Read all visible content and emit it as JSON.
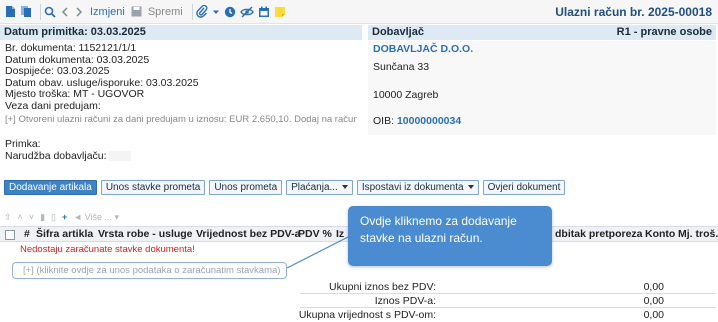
{
  "toolbar": {
    "izmjeni": "Izmjeni",
    "spremi": "Spremi"
  },
  "doc_title": "Ulazni račun br. 2025-00018",
  "left": {
    "header": "Datum primitka: 03.03.2025",
    "br_dokumenta": "Br. dokumenta: 1152121/1/1",
    "datum_dokumenta": "Datum dokumenta: 03.03.2025",
    "dospijece": "Dospijeće: 03.03.2025",
    "datum_obav": "Datum obav. usluge/isporuke: 03.03.2025",
    "mjesto_troska": "Mjesto troška: MT - UGOVOR",
    "veza": "Veza dani predujam:",
    "advance": "[+] Otvoreni ulazni računi za dani predujam u iznosu: EUR 2.650,10. Dodaj na račun...",
    "primka": "Primka:",
    "narudzba": "Narudžba dobavljaču:"
  },
  "right": {
    "header_left": "Dobavljač",
    "header_right": "R1 - pravne osobe",
    "name": "DOBAVLJAČ D.O.O.",
    "street": "Sunčana 33",
    "city": "10000   Zagreb",
    "oib_label": "OIB:",
    "oib_value": "10000000034"
  },
  "actions": {
    "dodavanje": "Dodavanje artikala",
    "unos_stavke": "Unos stavke prometa",
    "unos_prometa": "Unos prometa",
    "placanja": "Plaćanja...",
    "ispostavi": "Ispostavi iz dokumenta",
    "ovjeri": "Ovjeri dokument"
  },
  "gridbar": {
    "vise": "Više ..."
  },
  "table": {
    "col_num": "#",
    "col_sifra": "Šifra artikla",
    "col_vrsta": "Vrsta robe - usluge",
    "col_vrijednost": "Vrijednost bez PDV-a",
    "col_pdv": "PDV %",
    "col_iz": "Iz",
    "col_odbitak": "dbitak pretporeza",
    "col_konto": "Konto",
    "col_mj": "Mj. troš.",
    "missing": "Nedostaju zaračunate stavke dokumenta!",
    "add_row": "[+] (kliknite ovdje za unos podataka o zaračunatim stavkama)"
  },
  "totals": {
    "bez_pdv_label": "Ukupni iznos bez PDV:",
    "bez_pdv_value": "0,00",
    "pdv_label": "Iznos PDV-a:",
    "pdv_value": "0,00",
    "s_pdv_label": "Ukupna vrijednost s PDV-om:",
    "s_pdv_value": "0,00"
  },
  "tooltip": {
    "text": "Ovdje kliknemo za dodavanje stavke na ulazni račun."
  },
  "colors": {
    "accent": "#2a6fb6",
    "header_bg": "#dde9f3",
    "tooltip_bg": "#4b8bd0",
    "error": "#d42020"
  }
}
